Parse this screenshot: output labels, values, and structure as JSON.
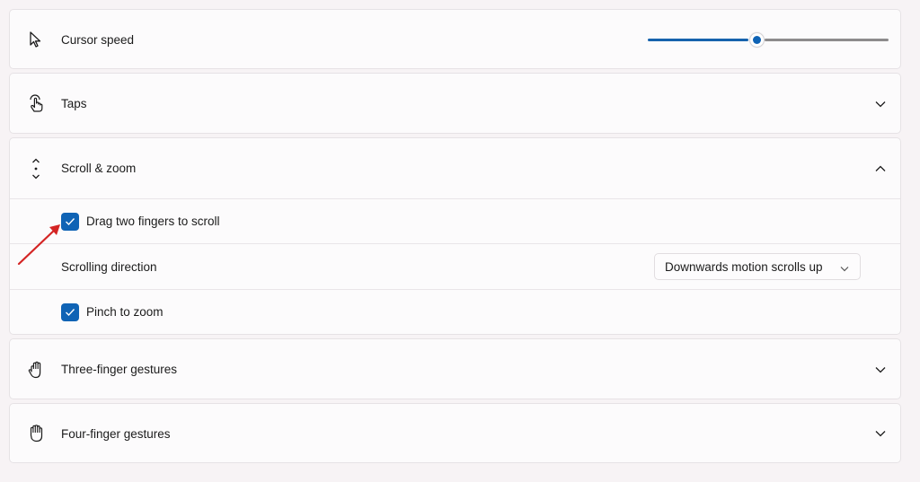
{
  "cursor_speed": {
    "label": "Cursor speed",
    "slider_value": 0.45
  },
  "taps": {
    "label": "Taps"
  },
  "scroll_zoom": {
    "label": "Scroll & zoom",
    "drag_two_fingers": {
      "label": "Drag two fingers to scroll",
      "checked": true
    },
    "scrolling_direction": {
      "label": "Scrolling direction",
      "value": "Downwards motion scrolls up"
    },
    "pinch_to_zoom": {
      "label": "Pinch to zoom",
      "checked": true
    }
  },
  "three_finger": {
    "label": "Three-finger gestures"
  },
  "four_finger": {
    "label": "Four-finger gestures"
  },
  "colors": {
    "accent": "#0f63b5",
    "annotation_arrow": "#d42424"
  }
}
